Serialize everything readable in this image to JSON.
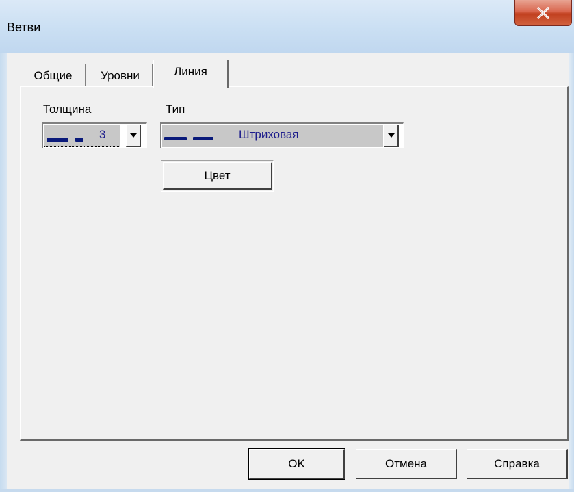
{
  "window": {
    "title": "Ветви"
  },
  "tabs": [
    {
      "label": "Общие",
      "active": false
    },
    {
      "label": "Уровни",
      "active": false
    },
    {
      "label": "Линия",
      "active": true
    }
  ],
  "line_tab": {
    "thickness": {
      "label": "Толщина",
      "value": "3"
    },
    "type": {
      "label": "Тип",
      "value": "Штриховая"
    },
    "color_button": "Цвет"
  },
  "footer": {
    "ok_label": "OK",
    "cancel_label": "Отмена",
    "help_label": "Справка"
  },
  "colors": {
    "line_sample": "#0a1a7a",
    "value_text": "#1d1d8c",
    "close_button": "#c9462a"
  },
  "icons": {
    "close": "close-icon",
    "dropdown": "chevron-down-icon"
  }
}
